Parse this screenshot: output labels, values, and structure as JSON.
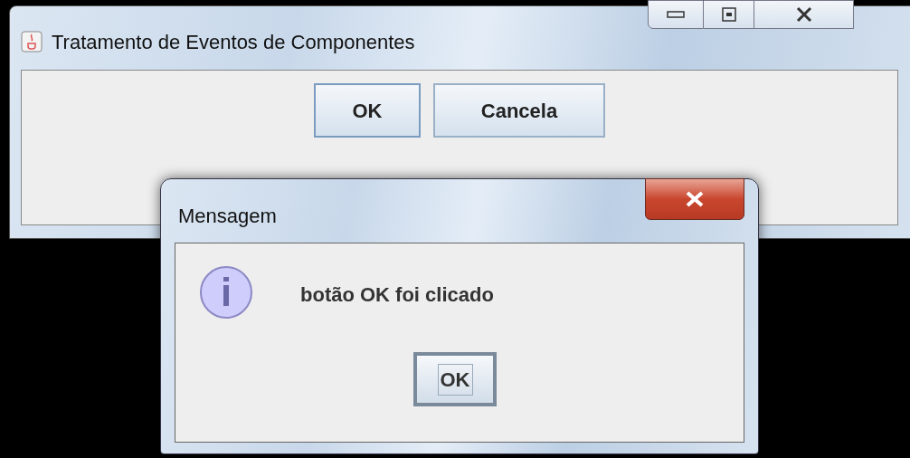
{
  "main_window": {
    "title": "Tratamento de Eventos de Componentes",
    "buttons": [
      "OK",
      "Cancela"
    ]
  },
  "dialog": {
    "title": "Mensagem",
    "message": "botão OK foi clicado",
    "buttons": [
      "OK"
    ]
  }
}
